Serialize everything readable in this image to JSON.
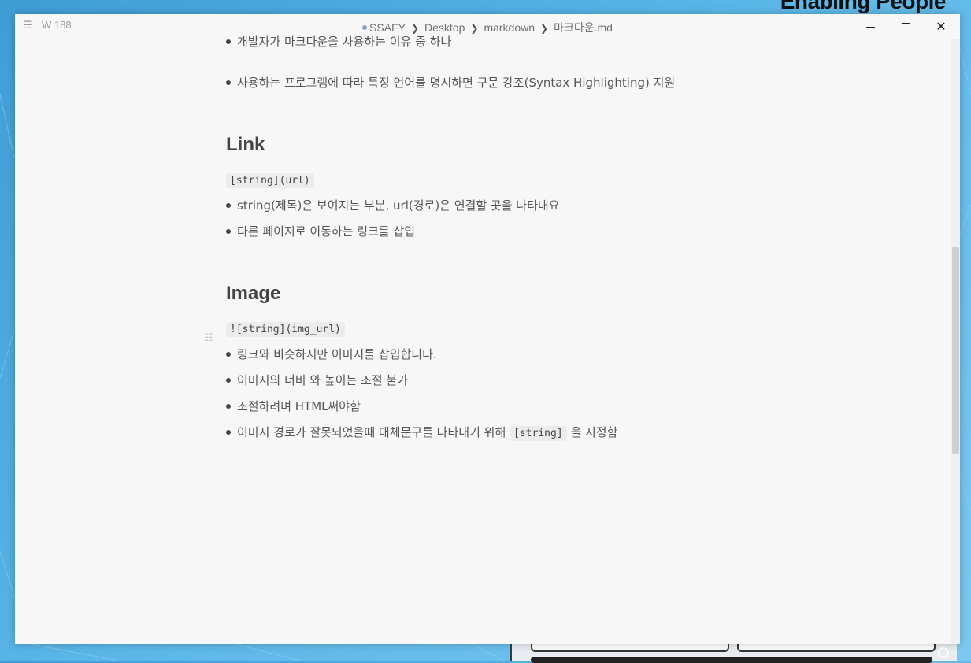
{
  "desktop": {
    "brand": "Enabling People"
  },
  "window": {
    "word_count": "W 188",
    "breadcrumb": [
      "SSAFY",
      "Desktop",
      "markdown",
      "마크다운.md"
    ],
    "controls": {
      "minimize": "—",
      "maximize": "☐",
      "close": "✕"
    }
  },
  "document": {
    "top_items": [
      "개발자가 마크다운을 사용하는 이유 중 하나",
      "사용하는 프로그램에 따라 특정 언어를 명시하면 구문 강조(Syntax Highlighting) 지원"
    ],
    "link": {
      "heading": "Link",
      "code": "[string](url)",
      "items": [
        "string(제목)은 보여지는 부분, url(경로)은 연결할 곳을 나타내요",
        "다른 페이지로 이동하는 링크를 삽입"
      ]
    },
    "image": {
      "heading": "Image",
      "code": "![string](img_url)",
      "items": [
        "링크와 비슷하지만 이미지를 삽입합니다.",
        "이미지의 너비 와 높이는 조절 불가",
        "조절하려며 HTML써야함"
      ],
      "last_item": {
        "before": "이미지 경로가 잘못되었을때 대체문구를 나타내기 위해",
        "code": "[string]",
        "after": "을 지정함"
      }
    }
  },
  "colors": {
    "desktop_accent": "#4aa8df",
    "window_bg": "#f7f7f7",
    "text": "#555555"
  }
}
